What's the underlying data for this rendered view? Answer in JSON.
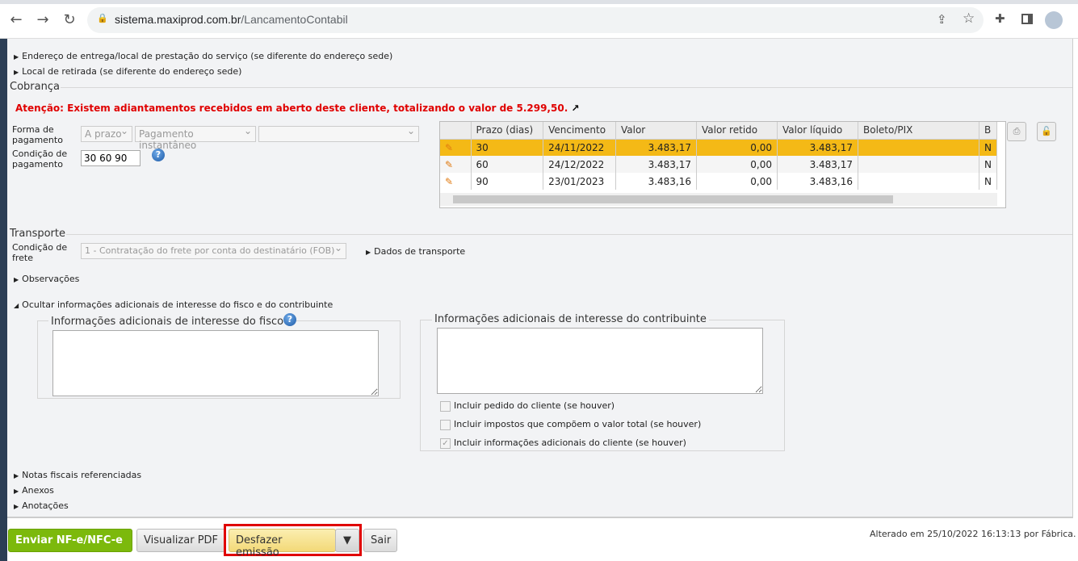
{
  "browser": {
    "url_host": "sistema.maxiprod.com.br",
    "url_path": "/LancamentoContabil"
  },
  "sections": {
    "endereco_entrega": "Endereço de entrega/local de prestação do serviço (se diferente do endereço sede)",
    "local_retirada": "Local de retirada (se diferente do endereço sede)",
    "cobranca": "Cobrança",
    "alert": "Atenção: Existem adiantamentos recebidos em aberto deste cliente, totalizando o valor de 5.299,50.",
    "forma_pagamento_label": "Forma de pagamento",
    "forma_pagamento_values": [
      "A prazo",
      "Pagamento instantâneo",
      ""
    ],
    "condicao_label": "Condição de pagamento",
    "condicao_value": "30 60 90",
    "transporte": "Transporte",
    "condicao_frete_label": "Condição de frete",
    "condicao_frete_value": "1 - Contratação do frete por conta do destinatário (FOB)",
    "dados_transporte": "Dados de transporte",
    "observacoes": "Observações",
    "ocultar_info": "Ocultar informações adicionais de interesse do fisco e do contribuinte",
    "info_fisco": "Informações adicionais de interesse do fisco",
    "info_contribuinte": "Informações adicionais de interesse do contribuinte",
    "cb1": "Incluir pedido do cliente (se houver)",
    "cb2": "Incluir impostos que compõem o valor total (se houver)",
    "cb3": "Incluir informações adicionais do cliente (se houver)",
    "notas": "Notas fiscais referenciadas",
    "anexos": "Anexos",
    "anotacoes": "Anotações"
  },
  "grid": {
    "headers": [
      "Prazo (dias)",
      "Vencimento",
      "Valor",
      "Valor retido",
      "Valor líquido",
      "Boleto/PIX",
      "B"
    ],
    "rows": [
      [
        "30",
        "24/11/2022",
        "3.483,17",
        "0,00",
        "3.483,17",
        "",
        "N"
      ],
      [
        "60",
        "24/12/2022",
        "3.483,17",
        "0,00",
        "3.483,17",
        "",
        "N"
      ],
      [
        "90",
        "23/01/2023",
        "3.483,16",
        "0,00",
        "3.483,16",
        "",
        "N"
      ]
    ]
  },
  "footer": {
    "enviar": "Enviar NF-e/NFC-e",
    "visualizar": "Visualizar PDF",
    "desfazer": "Desfazer emissão",
    "sair": "Sair",
    "alterado": "Alterado em 25/10/2022 16:13:13 por Fábrica."
  }
}
